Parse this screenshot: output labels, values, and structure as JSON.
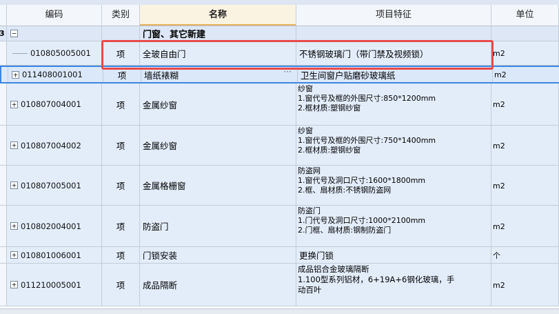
{
  "headers": {
    "code": "编码",
    "category": "类别",
    "name": "名称",
    "feature": "项目特征",
    "unit": "单位"
  },
  "group": {
    "row_num": "3",
    "toggle": "−",
    "title": "门窗、其它新建"
  },
  "rows": [
    {
      "code": "010805005001",
      "category": "项",
      "name": "全玻自由门",
      "feature": [
        "不锈钢玻璃门（带门禁及视频锁）"
      ],
      "unit": "m2"
    },
    {
      "code": "011408001001",
      "category": "项",
      "name": "墙纸裱糊",
      "feature": [
        "卫生间窗户贴磨砂玻璃纸"
      ],
      "unit": "m2",
      "more": "···"
    },
    {
      "code": "010807004001",
      "category": "项",
      "name": "金属纱窗",
      "feature": [
        "纱窗",
        "1.窗代号及框的外围尺寸:850*1200mm",
        "2.框材质:塑钢纱窗"
      ],
      "unit": "m2"
    },
    {
      "code": "010807004002",
      "category": "项",
      "name": "金属纱窗",
      "feature": [
        "纱窗",
        "1.窗代号及框的外围尺寸:750*1400mm",
        "2.框材质:塑钢纱窗"
      ],
      "unit": "m2"
    },
    {
      "code": "010807005001",
      "category": "项",
      "name": "金属格栅窗",
      "feature": [
        "防盗网",
        "1.窗代号及洞口尺寸:1600*1800mm",
        "2.框、扇材质:不锈钢防盗网"
      ],
      "unit": "m2"
    },
    {
      "code": "010802004001",
      "category": "项",
      "name": "防盗门",
      "feature": [
        "防盗门",
        "1.门代号及洞口尺寸:1000*2100mm",
        "2.门框、扇材质:钢制防盗门"
      ],
      "unit": "m2"
    },
    {
      "code": "010801006001",
      "category": "项",
      "name": "门锁安装",
      "feature": [
        "更换门锁"
      ],
      "unit": "个"
    },
    {
      "code": "011210005001",
      "category": "项",
      "name": "成品隔断",
      "feature": [
        "成品铝合金玻璃隔断",
        "1.100型系列铝材，6+19A+6钢化玻璃，手",
        "动百叶"
      ],
      "unit": "m2"
    }
  ],
  "expand_symbol": "+"
}
